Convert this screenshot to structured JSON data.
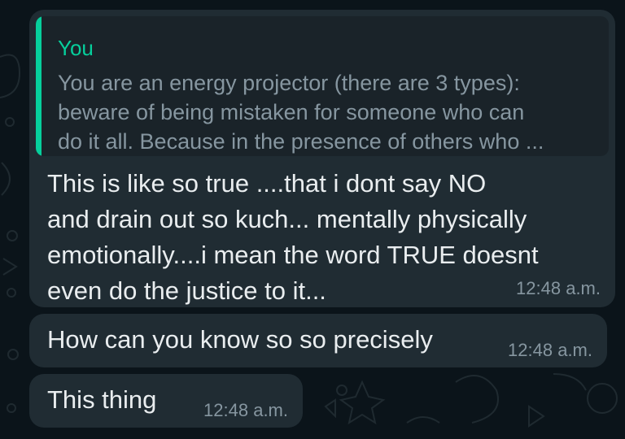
{
  "quote": {
    "author": "You",
    "lines": [
      "You are an energy projector (there are 3 types):",
      "beware of being mistaken for someone who can",
      "do it all. Because in the presence of others who ..."
    ]
  },
  "messages": [
    {
      "lines": [
        "This is like so true ....that i dont say NO",
        "and drain out so kuch... mentally physically",
        "emotionally....i mean the word TRUE doesnt",
        "even do the justice to it..."
      ],
      "time": "12:48 a.m."
    },
    {
      "lines": [
        "How can you know so so precisely"
      ],
      "time": "12:48 a.m."
    },
    {
      "lines": [
        "This thing"
      ],
      "time": "12:48 a.m."
    }
  ],
  "colors": {
    "background": "#0b141a",
    "bubble": "#202c33",
    "quote_accent": "#06cf9c",
    "text": "#e9edef",
    "muted": "#8696a0"
  }
}
